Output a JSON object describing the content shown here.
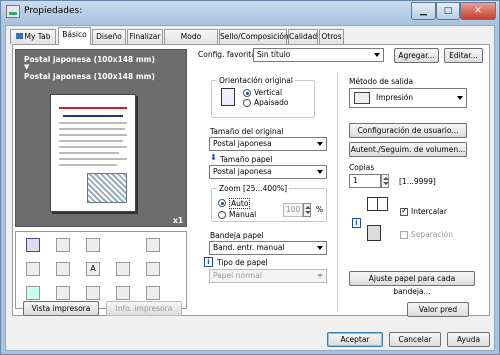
{
  "window": {
    "title": "Propiedades:"
  },
  "tabs": [
    {
      "label": "My Tab"
    },
    {
      "label": "Básico"
    },
    {
      "label": "Diseño"
    },
    {
      "label": "Finalizar"
    },
    {
      "label": "Modo portada"
    },
    {
      "label": "Sello/Composición"
    },
    {
      "label": "Calidad"
    },
    {
      "label": "Otros"
    }
  ],
  "preview": {
    "line1": "Postal japonesa (100x148 mm)",
    "arrow": "▼",
    "line2": "Postal japonesa (100x148 mm)",
    "copies_badge": "x1"
  },
  "left_buttons": {
    "view_printer": "Vista impresora",
    "printer_info": "Info. impresora"
  },
  "config": {
    "label": "Config. favorita",
    "value": "Sin título",
    "add": "Agregar...",
    "edit": "Editar..."
  },
  "orientation": {
    "title": "Orientación original",
    "vertical": "Vertical",
    "landscape": "Apaisado"
  },
  "original_size": {
    "label": "Tamaño del original",
    "value": "Postal japonesa"
  },
  "paper_size": {
    "label": "Tamaño papel",
    "value": "Postal japonesa"
  },
  "zoom": {
    "title": "Zoom [25...400%]",
    "auto": "Auto",
    "manual": "Manual",
    "value": "100",
    "unit": "%"
  },
  "tray": {
    "label": "Bandeja papel",
    "value": "Band. entr. manual"
  },
  "paper_type": {
    "label": "Tipo de papel",
    "value": "Papel normal"
  },
  "output": {
    "label": "Método de salida",
    "value": "Impresión"
  },
  "user_settings": "Configuración de usuario...",
  "auth": "Autent./Seguim. de volumen...",
  "copies": {
    "label": "Copias",
    "value": "1",
    "range": "[1...9999]"
  },
  "collate": {
    "label": "Intercalar"
  },
  "separation": {
    "label": "Separación"
  },
  "adjust_paper": "Ajuste papel para cada bandeja...",
  "default_btn": "Valor pred",
  "footer": {
    "accept": "Aceptar",
    "cancel": "Cancelar",
    "help": "Ayuda"
  }
}
